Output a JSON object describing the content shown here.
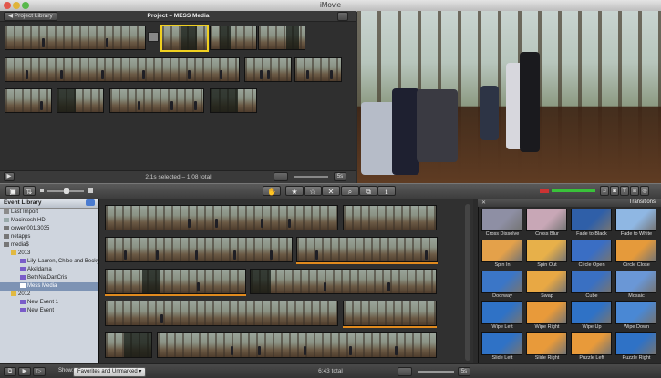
{
  "window": {
    "title": "iMovie"
  },
  "project": {
    "library_button": "Project Library",
    "title": "Project – MESS Media",
    "status": "2.1s selected – 1:08 total"
  },
  "event_library": {
    "header": "Event Library",
    "items": [
      {
        "label": "Last Import",
        "icon": "clock-icon"
      },
      {
        "label": "Macintosh HD",
        "icon": "hard-drive-icon"
      },
      {
        "label": "cowen001.3035",
        "icon": "drive-icon"
      },
      {
        "label": "netapps",
        "icon": "drive-icon"
      },
      {
        "label": "media$",
        "icon": "drive-icon"
      },
      {
        "label": "2013",
        "icon": "folder-icon"
      },
      {
        "label": "Lily, Lauren, Chloe and Becky",
        "icon": "event-icon"
      },
      {
        "label": "Akeldama",
        "icon": "event-icon"
      },
      {
        "label": "BethNatDanCris",
        "icon": "event-icon"
      },
      {
        "label": "Mess Media",
        "icon": "event-icon"
      },
      {
        "label": "2012",
        "icon": "folder-icon"
      },
      {
        "label": "New Event 1",
        "icon": "event-icon"
      },
      {
        "label": "New Event",
        "icon": "event-icon"
      }
    ]
  },
  "transitions": {
    "header": "Transitions",
    "items": [
      {
        "label": "Cross Dissolve",
        "color": "#8e8fa4"
      },
      {
        "label": "Cross Blur",
        "color": "#c8a7b6"
      },
      {
        "label": "Fade to Black",
        "color": "#2f5fa8"
      },
      {
        "label": "Fade to White",
        "color": "#8fb7e3"
      },
      {
        "label": "Spin In",
        "color": "#e4a14a"
      },
      {
        "label": "Spin Out",
        "color": "#e7b04a"
      },
      {
        "label": "Circle Open",
        "color": "#3a6ec4"
      },
      {
        "label": "Circle Close",
        "color": "#e59a3b"
      },
      {
        "label": "Doorway",
        "color": "#3b76c7"
      },
      {
        "label": "Swap",
        "color": "#e8a844"
      },
      {
        "label": "Cube",
        "color": "#3a70c2"
      },
      {
        "label": "Mosaic",
        "color": "#6a97d6"
      },
      {
        "label": "Wipe Left",
        "color": "#2f72c6"
      },
      {
        "label": "Wipe Right",
        "color": "#e89a3a"
      },
      {
        "label": "Wipe Up",
        "color": "#2f72c6"
      },
      {
        "label": "Wipe Down",
        "color": "#4a88d4"
      },
      {
        "label": "Slide Left",
        "color": "#2f72c6"
      },
      {
        "label": "Slide Right",
        "color": "#e89a3a"
      },
      {
        "label": "Puzzle Left",
        "color": "#e89a3a"
      },
      {
        "label": "Puzzle Right",
        "color": "#2f72c6"
      }
    ]
  },
  "bottom": {
    "show_label": "Show:",
    "filter_value": "Favorites and Unmarked",
    "total": "6:43 total",
    "zoom": "5s"
  },
  "colors": {
    "selection": "#f0d020",
    "volume_green": "#39c23a",
    "unused_marker": "#e08a1e"
  }
}
